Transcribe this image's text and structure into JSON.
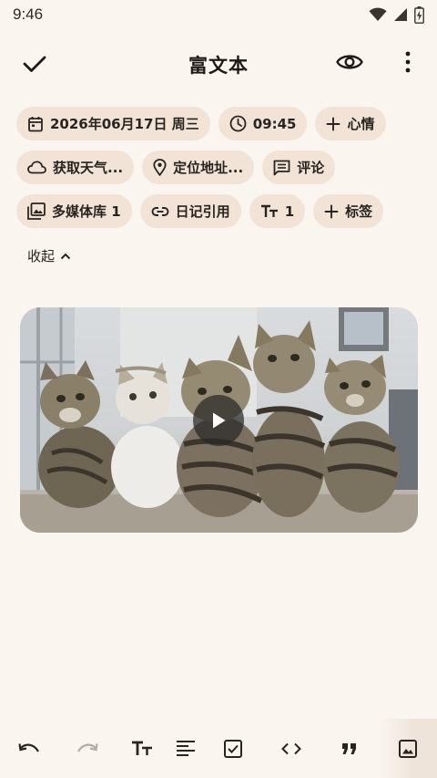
{
  "status_bar": {
    "time": "9:46"
  },
  "app_bar": {
    "title": "富文本"
  },
  "chips": {
    "date": "2026年06月17日 周三",
    "time": "09:45",
    "mood": "心情",
    "weather": "获取天气...",
    "location": "定位地址...",
    "comment": "评论",
    "media_library": "多媒体库 1",
    "diary_ref": "日记引用",
    "text_size": "1",
    "tag": "标签"
  },
  "collapse_label": "收起",
  "media": {
    "type": "video",
    "description_icon": "play-icon"
  },
  "colors": {
    "background": "#fbf5ef",
    "chip": "#f1e4d7",
    "text": "#1f1a17"
  }
}
